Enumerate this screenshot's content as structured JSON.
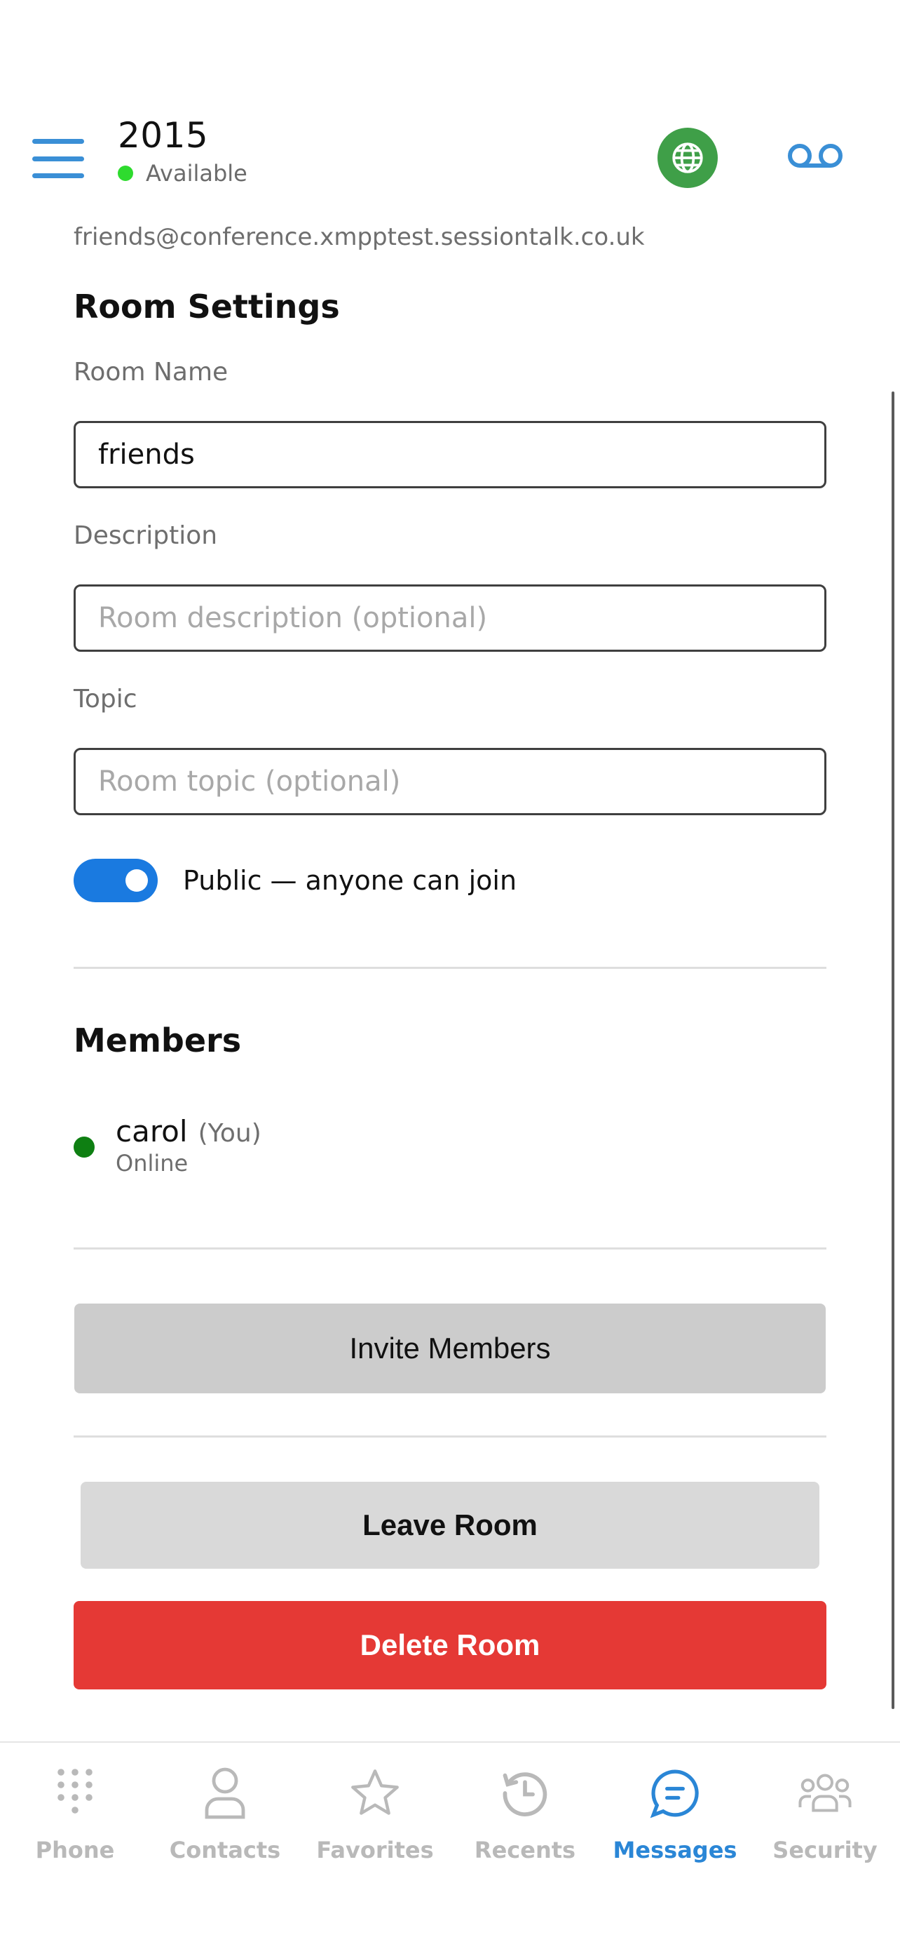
{
  "header": {
    "account_name": "2015",
    "presence": "Available"
  },
  "room": {
    "jid": "friends@conference.xmpptest.sessiontalk.co.uk",
    "settings_title": "Room Settings",
    "name_label": "Room Name",
    "name_value": "friends",
    "description_label": "Description",
    "description_placeholder": "Room description (optional)",
    "topic_label": "Topic",
    "topic_placeholder": "Room topic (optional)",
    "public_toggle_label": "Public — anyone can join",
    "public_toggle_on": true
  },
  "members": {
    "title": "Members",
    "list": [
      {
        "name": "carol",
        "tag": "(You)",
        "status": "Online"
      }
    ]
  },
  "actions": {
    "invite_label": "Invite Members",
    "leave_label": "Leave Room",
    "delete_label": "Delete Room"
  },
  "tabs": [
    {
      "label": "Phone",
      "icon": "dialpad-icon",
      "active": false
    },
    {
      "label": "Contacts",
      "icon": "person-icon",
      "active": false
    },
    {
      "label": "Favorites",
      "icon": "star-icon",
      "active": false
    },
    {
      "label": "Recents",
      "icon": "history-icon",
      "active": false
    },
    {
      "label": "Messages",
      "icon": "chat-bubble-icon",
      "active": true
    },
    {
      "label": "Security",
      "icon": "group-icon",
      "active": false
    }
  ],
  "colors": {
    "accent": "#2a86d6",
    "presence_available": "#2edb2e",
    "globe_button": "#3f9f48",
    "toggle_on": "#1a7ae0",
    "member_online": "#0e7f12",
    "delete": "#e53935",
    "inactive_tab": "#b9b9b9"
  }
}
